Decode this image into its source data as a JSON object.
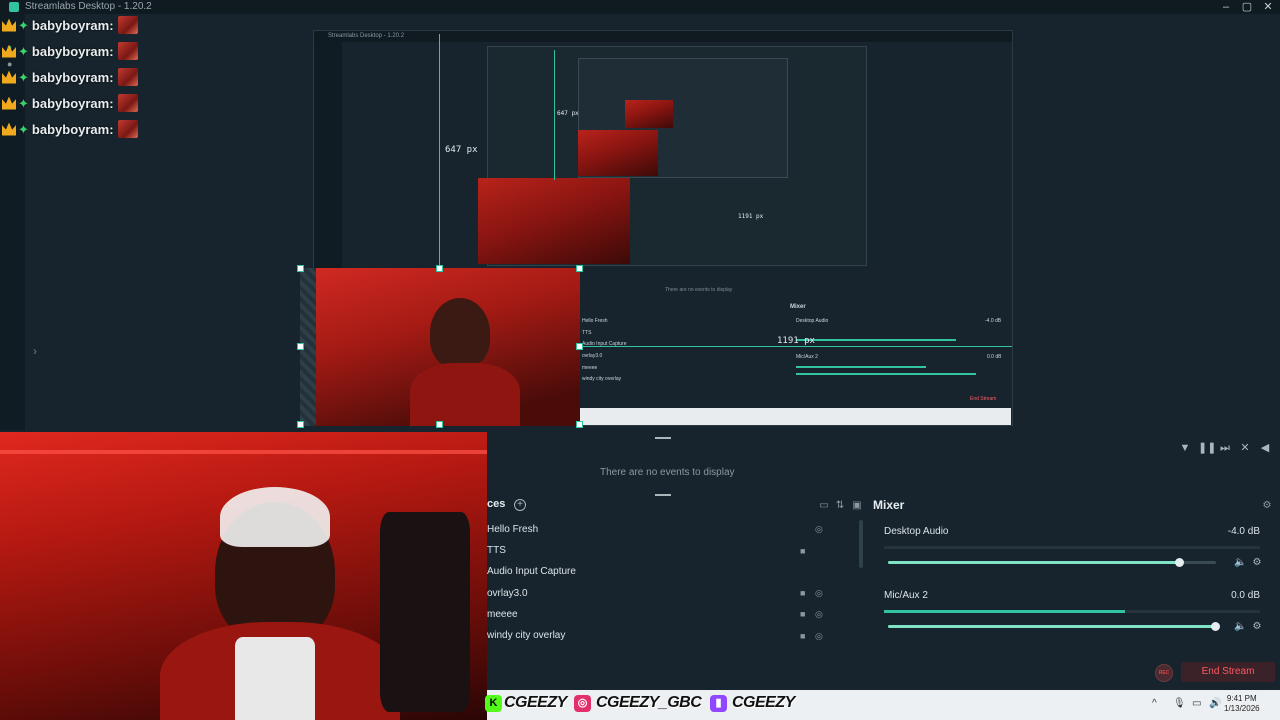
{
  "window": {
    "title": "Streamlabs Desktop - 1.20.2"
  },
  "chat": {
    "messages": [
      {
        "user": "babyboyram:"
      },
      {
        "user": "babyboyram:"
      },
      {
        "user": "babyboyram:"
      },
      {
        "user": "babyboyram:"
      },
      {
        "user": "babyboyram:"
      }
    ]
  },
  "preview": {
    "nested_title": "Streamlabs Desktop - 1.20.2",
    "height_label": "647 px",
    "width_label": "1191 px",
    "inner_height_label": "647 px",
    "inner_width_label": "1191 px",
    "nested_no_events": "There are no events to display",
    "nested_mixer": "Mixer",
    "nested_desktop_audio": "Desktop Audio",
    "nested_desktop_db": "-4.0 dB",
    "nested_mic": "Mic/Aux 2",
    "nested_mic_db": "0.0 dB",
    "nested_end_stream": "End Stream",
    "nested_sources": [
      "Hello Fresh",
      "TTS",
      "Audio Input Capture",
      "ovrlay3.0",
      "meeee",
      "windy city overlay"
    ]
  },
  "events": {
    "empty_text": "There are no events to display"
  },
  "sources": {
    "heading": "ces",
    "items": [
      {
        "label": "Hello Fresh"
      },
      {
        "label": "TTS"
      },
      {
        "label": "Audio Input Capture"
      },
      {
        "label": "ovrlay3.0"
      },
      {
        "label": "meeee"
      },
      {
        "label": "windy city overlay"
      }
    ]
  },
  "mixer": {
    "heading": "Mixer",
    "channels": [
      {
        "name": "Desktop Audio",
        "db": "-4.0 dB",
        "level": 0.0,
        "volume": 0.89
      },
      {
        "name": "Mic/Aux 2",
        "db": "0.0 dB",
        "level": 0.64,
        "volume": 1.0
      }
    ]
  },
  "footer": {
    "rec_label": "REC",
    "end_stream": "End Stream"
  },
  "overlay_socials": {
    "kick": "CGEEZY",
    "instagram": "CGEEZY_GBC",
    "twitch": "CGEEZY"
  },
  "taskbar": {
    "time": "9:41 PM",
    "date": "1/13/2026"
  },
  "colors": {
    "accent": "#31c3a2",
    "end_stream": "#ff5a63",
    "kick": "#53fc18",
    "twitch": "#9146ff",
    "instagram": "#e1306c"
  }
}
